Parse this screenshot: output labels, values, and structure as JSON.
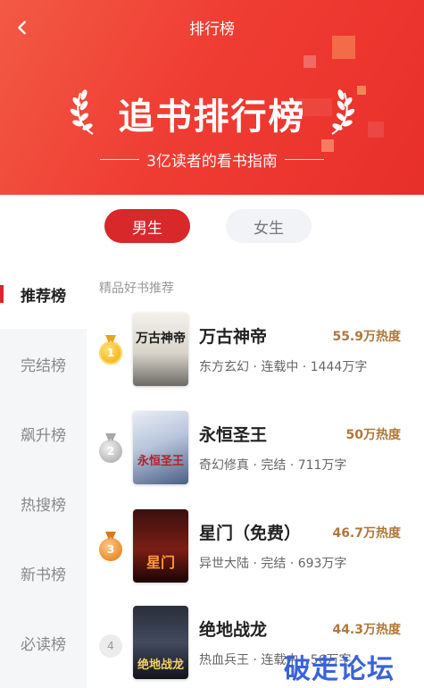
{
  "header": {
    "nav_title": "排行榜",
    "hero_title": "追书排行榜",
    "hero_subtitle": "3亿读者的看书指南"
  },
  "gender_tabs": [
    {
      "label": "男生",
      "selected": true
    },
    {
      "label": "女生",
      "selected": false
    }
  ],
  "sidebar": {
    "items": [
      {
        "label": "推荐榜",
        "active": true
      },
      {
        "label": "完结榜",
        "active": false
      },
      {
        "label": "飙升榜",
        "active": false
      },
      {
        "label": "热搜榜",
        "active": false
      },
      {
        "label": "新书榜",
        "active": false
      },
      {
        "label": "必读榜",
        "active": false
      }
    ]
  },
  "main": {
    "section_title": "精品好书推荐",
    "books": [
      {
        "rank": "1",
        "title": "万古神帝",
        "heat": "55.9万热度",
        "meta": "东方玄幻 · 连载中 · 1444万字",
        "cover_text": "万古神帝"
      },
      {
        "rank": "2",
        "title": "永恒圣王",
        "heat": "50万热度",
        "meta": "奇幻修真 · 完结 · 711万字",
        "cover_text": "永恒圣王"
      },
      {
        "rank": "3",
        "title": "星门（免费）",
        "heat": "46.7万热度",
        "meta": "异世大陆 · 完结 · 693万字",
        "cover_text": "星门"
      },
      {
        "rank": "4",
        "title": "绝地战龙",
        "heat": "44.3万热度",
        "meta": "热血兵王 · 连载中 · 56万字",
        "cover_text": "绝地战龙"
      }
    ]
  },
  "watermark": "破走论坛",
  "colors": {
    "accent": "#d8282a",
    "banner": "#ef3d33",
    "heat": "#b0773a"
  }
}
